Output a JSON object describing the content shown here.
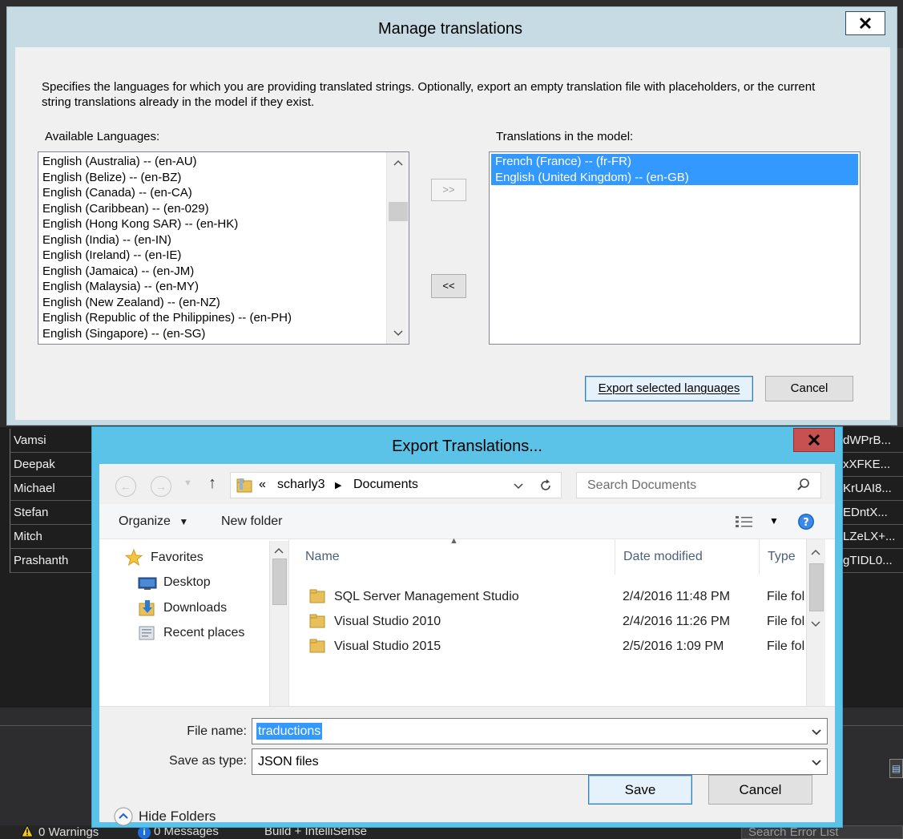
{
  "background": {
    "grid_rows_left": [
      "Vamsi",
      "Deepak",
      "Michael",
      "Stefan",
      "Mitch",
      "Prashanth"
    ],
    "grid_rows_right": [
      "dWPrB...",
      "xXFKE...",
      "KrUAI8...",
      "EDntX...",
      "LZeLX+...",
      "gTIDL0..."
    ],
    "statusbar": {
      "warnings": "0 Warnings",
      "messages": "0 Messages",
      "filter": "Build + IntelliSense",
      "search": "Search Error List"
    }
  },
  "manage_translations": {
    "title": "Manage translations",
    "close_label": "X",
    "description": "Specifies the languages for which you are providing translated strings. Optionally, export an empty translation file with placeholders, or the current string translations already in the model if they exist.",
    "available_label": "Available Languages:",
    "model_label": "Translations in the model:",
    "available_languages": [
      "English (Australia) -- (en-AU)",
      "English (Belize) -- (en-BZ)",
      "English (Canada) -- (en-CA)",
      "English (Caribbean) -- (en-029)",
      "English (Hong Kong SAR) -- (en-HK)",
      "English (India) -- (en-IN)",
      "English (Ireland) -- (en-IE)",
      "English (Jamaica) -- (en-JM)",
      "English (Malaysia) -- (en-MY)",
      "English (New Zealand) -- (en-NZ)",
      "English (Republic of the Philippines) -- (en-PH)",
      "English (Singapore) -- (en-SG)"
    ],
    "model_languages": [
      "French (France) -- (fr-FR)",
      "English (United Kingdom) -- (en-GB)"
    ],
    "add_button": ">>",
    "remove_button": "<<",
    "export_button": "Export selected languages",
    "cancel_button": "Cancel"
  },
  "export_dialog": {
    "title": "Export Translations...",
    "close_label": "X",
    "address": {
      "prefix": "«",
      "segments": [
        "scharly3",
        "Documents"
      ]
    },
    "search_placeholder": "Search Documents",
    "toolbar": {
      "organize": "Organize",
      "new_folder": "New folder"
    },
    "nav": {
      "favorites": "Favorites",
      "items": [
        "Desktop",
        "Downloads",
        "Recent places"
      ]
    },
    "columns": {
      "name": "Name",
      "date": "Date modified",
      "type": "Type"
    },
    "files": [
      {
        "name": "SQL Server Management Studio",
        "date": "2/4/2016 11:48 PM",
        "type": "File fol"
      },
      {
        "name": "Visual Studio 2010",
        "date": "2/4/2016 11:26 PM",
        "type": "File fol"
      },
      {
        "name": "Visual Studio 2015",
        "date": "2/5/2016 1:09 PM",
        "type": "File fol"
      }
    ],
    "file_name_label": "File name:",
    "file_name_value": "traductions",
    "save_type_label": "Save as type:",
    "save_type_value": "JSON files",
    "hide_folders": "Hide Folders",
    "save_button": "Save",
    "cancel_button": "Cancel"
  }
}
